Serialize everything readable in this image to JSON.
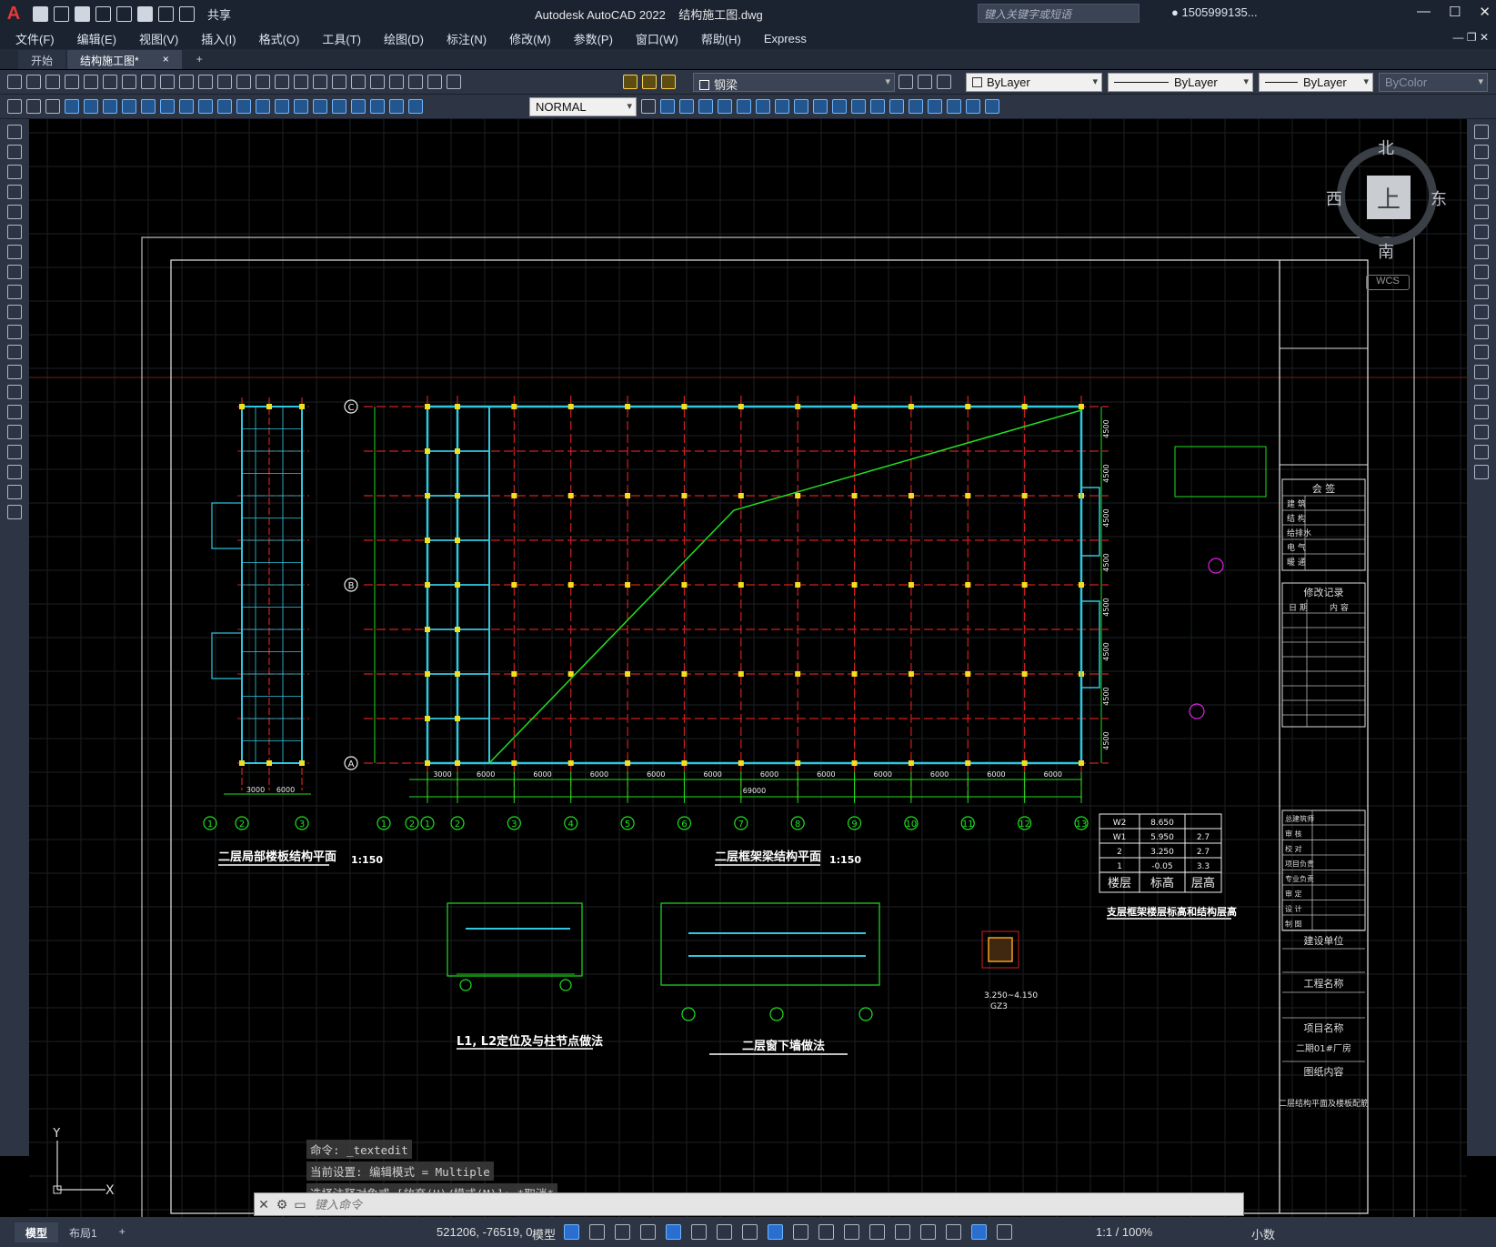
{
  "app": {
    "logo": "A",
    "title": "Autodesk AutoCAD 2022    结构施工图.dwg",
    "share_label": "共享",
    "search_placeholder": "键入关键字或短语",
    "user": "1505999135...",
    "help": "?"
  },
  "menu": {
    "items": [
      "文件(F)",
      "编辑(E)",
      "视图(V)",
      "插入(I)",
      "格式(O)",
      "工具(T)",
      "绘图(D)",
      "标注(N)",
      "修改(M)",
      "参数(P)",
      "窗口(W)",
      "帮助(H)",
      "Express"
    ]
  },
  "tabs": {
    "start": "开始",
    "active": "结构施工图*",
    "close": "×",
    "new": "+"
  },
  "toolbar": {
    "layer": "钢梁",
    "color": "ByLayer",
    "linetype": "ByLayer",
    "lineweight": "ByLayer",
    "plotstyle": "ByColor",
    "dimstyle": "NORMAL"
  },
  "viewcube": {
    "north": "北",
    "south": "南",
    "east": "东",
    "west": "西",
    "top": "上",
    "wcs": "WCS"
  },
  "ucs": {
    "x": "X",
    "y": "Y"
  },
  "command": {
    "history": [
      "命令: _textedit",
      "当前设置: 编辑模式 = Multiple",
      "选择注释对象或 [放弃(U)/模式(M)]: *取消*"
    ],
    "placeholder": "键入命令"
  },
  "status": {
    "layouts": [
      "模型",
      "布局1"
    ],
    "add_layout": "+",
    "coords": "521206, -76519, 0",
    "model": "模型",
    "scale": "1:1 / 100%",
    "units": "小数"
  },
  "drawing": {
    "plan1_title": "二层局部楼板结构平面",
    "plan1_scale": "1:150",
    "plan2_title": "二层框架梁结构平面",
    "plan2_scale": "1:150",
    "detail1_title": "L1, L2定位及与柱节点做法",
    "detail2_title": "二层窗下墙做法",
    "gz_label": "GZ3",
    "gz_elev": "3.250~4.150",
    "table_title": "支层框架楼层标高和结构层高",
    "table_header": [
      "楼层",
      "标高",
      "层高"
    ],
    "table_rows": [
      [
        "W2",
        "8.650",
        ""
      ],
      [
        "W1",
        "5.950",
        "2.7"
      ],
      [
        "2",
        "3.250",
        "2.7"
      ],
      [
        "1",
        "-0.05",
        "3.3"
      ]
    ],
    "total_dim": "69000",
    "dims_bottom": [
      "3000",
      "6000",
      "6000",
      "6000",
      "6000",
      "6000",
      "6000",
      "6000",
      "6000",
      "6000",
      "6000",
      "6000"
    ],
    "dims_small": [
      "3000",
      "6000"
    ],
    "axis_numbers": [
      "1",
      "2",
      "3",
      "4",
      "5",
      "6",
      "7",
      "8",
      "9",
      "10",
      "11",
      "12",
      "13"
    ],
    "axis_letters": [
      "C",
      "B",
      "A"
    ],
    "right_dims": [
      "4500",
      "4500",
      "4500",
      "4500",
      "4500",
      "4500",
      "4500",
      "4500"
    ],
    "title_block": {
      "countersign": "会 签",
      "disciplines": [
        "建 筑",
        "结 构",
        "给排水",
        "电 气",
        "暖 通"
      ],
      "revisions": "修改记录",
      "rev_cols": [
        "日 期",
        "内 容"
      ],
      "roles": [
        "总建筑师",
        "审 核",
        "校 对",
        "项目负责",
        "专业负责",
        "审 定",
        "设 计",
        "制 图"
      ],
      "owner": "建设单位",
      "project_name_label": "工程名称",
      "item_name_label": "项目名称",
      "item_name": "二期01#厂房",
      "drawing_content_label": "图纸内容",
      "drawing_content": "二层结构平面及楼板配筋"
    }
  }
}
